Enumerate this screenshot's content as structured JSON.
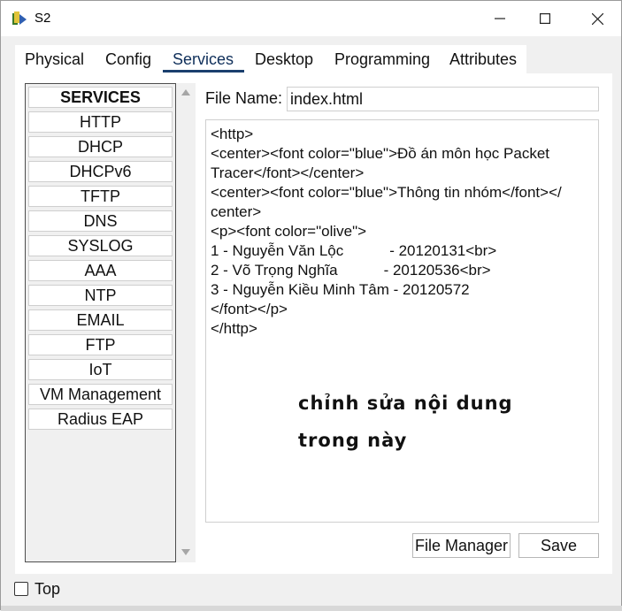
{
  "window": {
    "title": "S2"
  },
  "tabs": [
    "Physical",
    "Config",
    "Services",
    "Desktop",
    "Programming",
    "Attributes"
  ],
  "active_tab": "Services",
  "services": {
    "header": "SERVICES",
    "items": [
      "HTTP",
      "DHCP",
      "DHCPv6",
      "TFTP",
      "DNS",
      "SYSLOG",
      "AAA",
      "NTP",
      "EMAIL",
      "FTP",
      "IoT",
      "VM Management",
      "Radius EAP"
    ]
  },
  "file": {
    "label": "File Name:",
    "value": "index.html"
  },
  "editor": {
    "lines": [
      "<http>",
      "<center><font color=\"blue\">Đồ án môn học Packet",
      "Tracer</font></center>",
      "<center><font color=\"blue\">Thông tin nhóm</font></",
      "center>",
      "<p><font color=\"olive\">",
      "1 - Nguyễn Văn Lộc           - 20120131<br>",
      "2 - Võ Trọng Nghĩa           - 20120536<br>",
      "3 - Nguyễn Kiều Minh Tâm - 20120572",
      "</font></p>",
      "</http>"
    ],
    "note_line1": "chỉnh sửa nội dung",
    "note_line2": "trong này"
  },
  "buttons": {
    "file_manager": "File Manager",
    "save": "Save"
  },
  "footer": {
    "top_label": "Top",
    "top_checked": false
  }
}
